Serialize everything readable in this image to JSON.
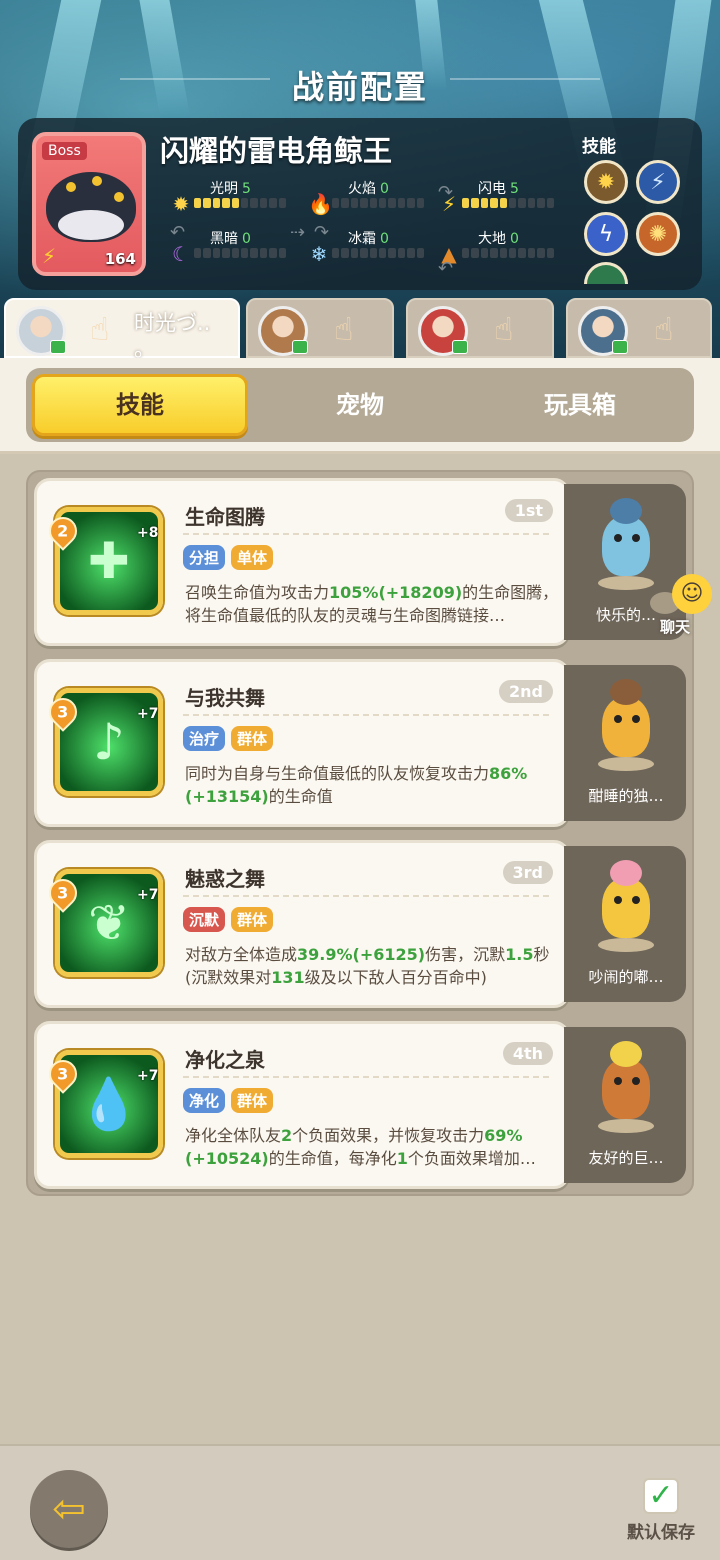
{
  "page": {
    "title": "战前配置"
  },
  "boss": {
    "tag": "Boss",
    "name": "闪耀的雷电角鲸王",
    "level": "164",
    "skills_label": "技能",
    "elements": [
      {
        "label": "光明",
        "value": "5",
        "icon": "sun-icon",
        "filled": 5
      },
      {
        "label": "火焰",
        "value": "0",
        "icon": "fire-icon",
        "filled": 0
      },
      {
        "label": "闪电",
        "value": "5",
        "icon": "lightning-icon",
        "filled": 5
      },
      {
        "label": "黑暗",
        "value": "0",
        "icon": "moon-icon",
        "filled": 0
      },
      {
        "label": "冰霜",
        "value": "0",
        "icon": "snowflake-icon",
        "filled": 0
      },
      {
        "label": "大地",
        "value": "0",
        "icon": "earth-icon",
        "filled": 0
      }
    ]
  },
  "heroes": [
    {
      "name": "时光づ..\n。",
      "active": true,
      "color": "#c7d1da"
    },
    {
      "name": "",
      "active": false,
      "color": "#b07a4c"
    },
    {
      "name": "",
      "active": false,
      "color": "#c8433e"
    },
    {
      "name": "",
      "active": false,
      "color": "#4d6f8e"
    }
  ],
  "tabs": [
    "技能",
    "宠物",
    "玩具箱"
  ],
  "skills": [
    {
      "name": "生命图腾",
      "rank": "1st",
      "level": "2",
      "plus": "+8",
      "tags": [
        {
          "text": "分担",
          "color": "blue"
        },
        {
          "text": "单体",
          "color": "gold"
        }
      ],
      "desc_parts": [
        "召唤生命值为攻击力",
        "105%(+18209)",
        "的生命图腾，将生命值最低的队友的灵魂与生命图腾链接…"
      ],
      "pet": "快乐的…"
    },
    {
      "name": "与我共舞",
      "rank": "2nd",
      "level": "3",
      "plus": "+7",
      "tags": [
        {
          "text": "治疗",
          "color": "blue"
        },
        {
          "text": "群体",
          "color": "gold"
        }
      ],
      "desc_parts": [
        "同时为自身与生命值最低的队友恢复攻击力",
        "86%(+13154)",
        "的生命值"
      ],
      "pet": "酣睡的独…"
    },
    {
      "name": "魅惑之舞",
      "rank": "3rd",
      "level": "3",
      "plus": "+7",
      "tags": [
        {
          "text": "沉默",
          "color": "red"
        },
        {
          "text": "群体",
          "color": "gold"
        }
      ],
      "desc_parts": [
        "对敌方全体造成",
        "39.9%(+6125)",
        "伤害，沉默",
        "1.5",
        "秒(沉默效果对",
        "131",
        "级及以下敌人百分百命中)"
      ],
      "pet": "吵闹的嘟…"
    },
    {
      "name": "净化之泉",
      "rank": "4th",
      "level": "3",
      "plus": "+7",
      "tags": [
        {
          "text": "净化",
          "color": "blue"
        },
        {
          "text": "群体",
          "color": "gold"
        }
      ],
      "desc_parts": [
        "净化全体队友",
        "2",
        "个负面效果，并恢复攻击力",
        "69%(+10524)",
        "的生命值，每净化",
        "1",
        "个负面效果增加…"
      ],
      "pet": "友好的巨…"
    }
  ],
  "chat": {
    "label": "聊天"
  },
  "footer": {
    "save_label": "默认保存"
  }
}
